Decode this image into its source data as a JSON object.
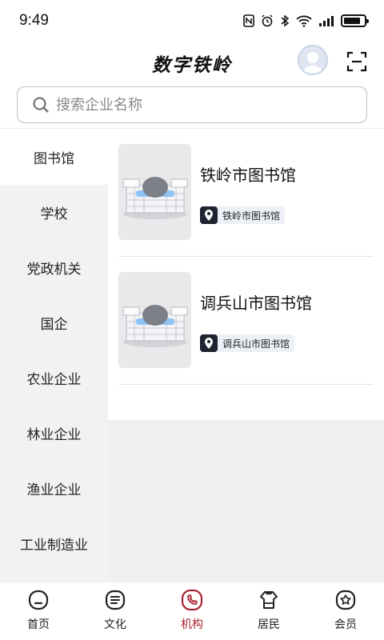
{
  "status": {
    "time": "9:49",
    "battery_level": 0.85
  },
  "header": {
    "title": "数字铁岭"
  },
  "search": {
    "placeholder": "搜索企业名称"
  },
  "sidebar": {
    "items": [
      {
        "label": "图书馆",
        "active": true
      },
      {
        "label": "学校"
      },
      {
        "label": "党政机关"
      },
      {
        "label": "国企"
      },
      {
        "label": "农业企业"
      },
      {
        "label": "林业企业"
      },
      {
        "label": "渔业企业"
      },
      {
        "label": "工业制造业"
      }
    ]
  },
  "list": {
    "items": [
      {
        "title": "铁岭市图书馆",
        "tag": "铁岭市图书馆"
      },
      {
        "title": "调兵山市图书馆",
        "tag": "调兵山市图书馆"
      }
    ]
  },
  "nav": {
    "items": [
      {
        "label": "首页",
        "icon": "home-icon"
      },
      {
        "label": "文化",
        "icon": "culture-icon"
      },
      {
        "label": "机构",
        "icon": "institution-icon",
        "active": true
      },
      {
        "label": "居民",
        "icon": "residents-icon"
      },
      {
        "label": "会员",
        "icon": "member-icon"
      }
    ],
    "active_color": "#a8222c"
  }
}
